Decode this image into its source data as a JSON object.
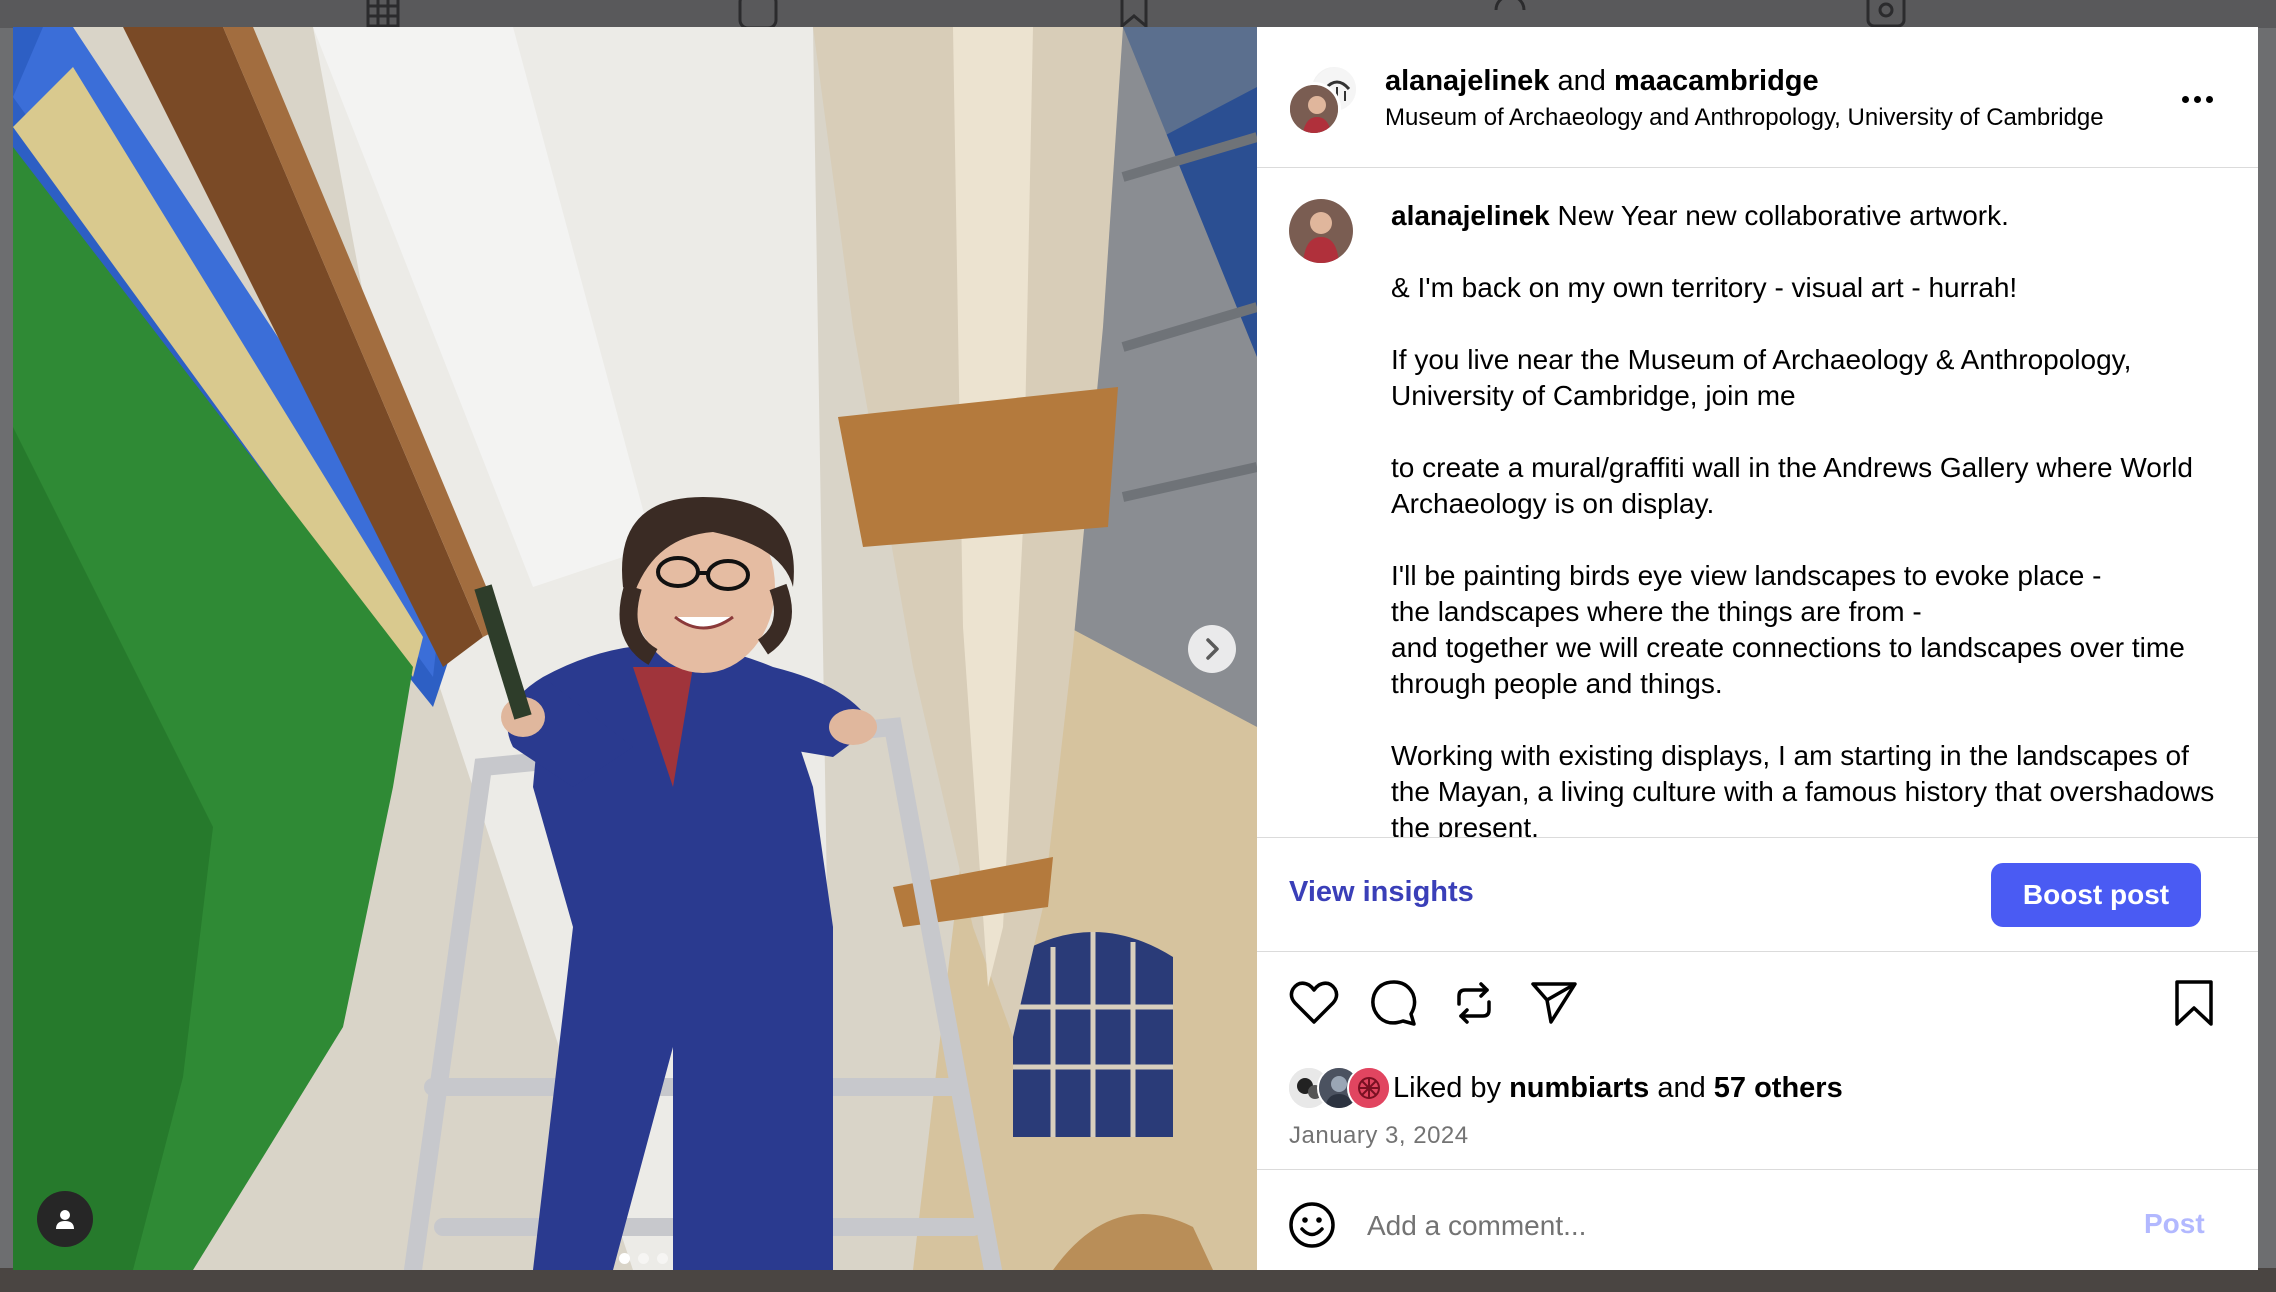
{
  "header": {
    "user1": "alanajelinek",
    "connector": "and",
    "user2": "maacambridge",
    "location": "Museum of Archaeology and Anthropology, University of Cambridge",
    "more_icon": "more-horizontal-icon"
  },
  "caption": {
    "username": "alanajelinek",
    "paragraphs": [
      "New Year new collaborative artwork.",
      "& I'm back on my own territory - visual art - hurrah!",
      "If you live near the Museum of Archaeology & Anthropology, University of Cambridge, join me",
      "to create a mural/graffiti wall in the Andrews Gallery where World Archaeology is on display.",
      "I'll be painting birds eye view landscapes to evoke place -\nthe landscapes where the things are from -\nand together we will create connections to landscapes over time through people and things.",
      "Working with existing displays, I am starting in the landscapes of the Mayan, a living culture with a famous history that overshadows the present."
    ]
  },
  "insights": {
    "view_label": "View insights",
    "boost_label": "Boost post"
  },
  "actions": {
    "like_icon": "heart-icon",
    "comment_icon": "comment-icon",
    "repost_icon": "repost-icon",
    "share_icon": "send-icon",
    "save_icon": "bookmark-icon"
  },
  "likes": {
    "prefix": "Liked by",
    "user": "numbiarts",
    "connector": "and",
    "others": "57 others"
  },
  "date": "January 3, 2024",
  "comment": {
    "placeholder": "Add a comment...",
    "post_label": "Post",
    "emoji_icon": "emoji-icon"
  },
  "media": {
    "carousel_position": 1,
    "carousel_total": 3,
    "next_icon": "chevron-right-icon",
    "tag_icon": "user-tag-icon"
  },
  "colors": {
    "accent": "#4a5bf3",
    "insights_link": "#3a3fb8",
    "post_disabled": "#b2b8ff",
    "muted_text": "#737373"
  }
}
